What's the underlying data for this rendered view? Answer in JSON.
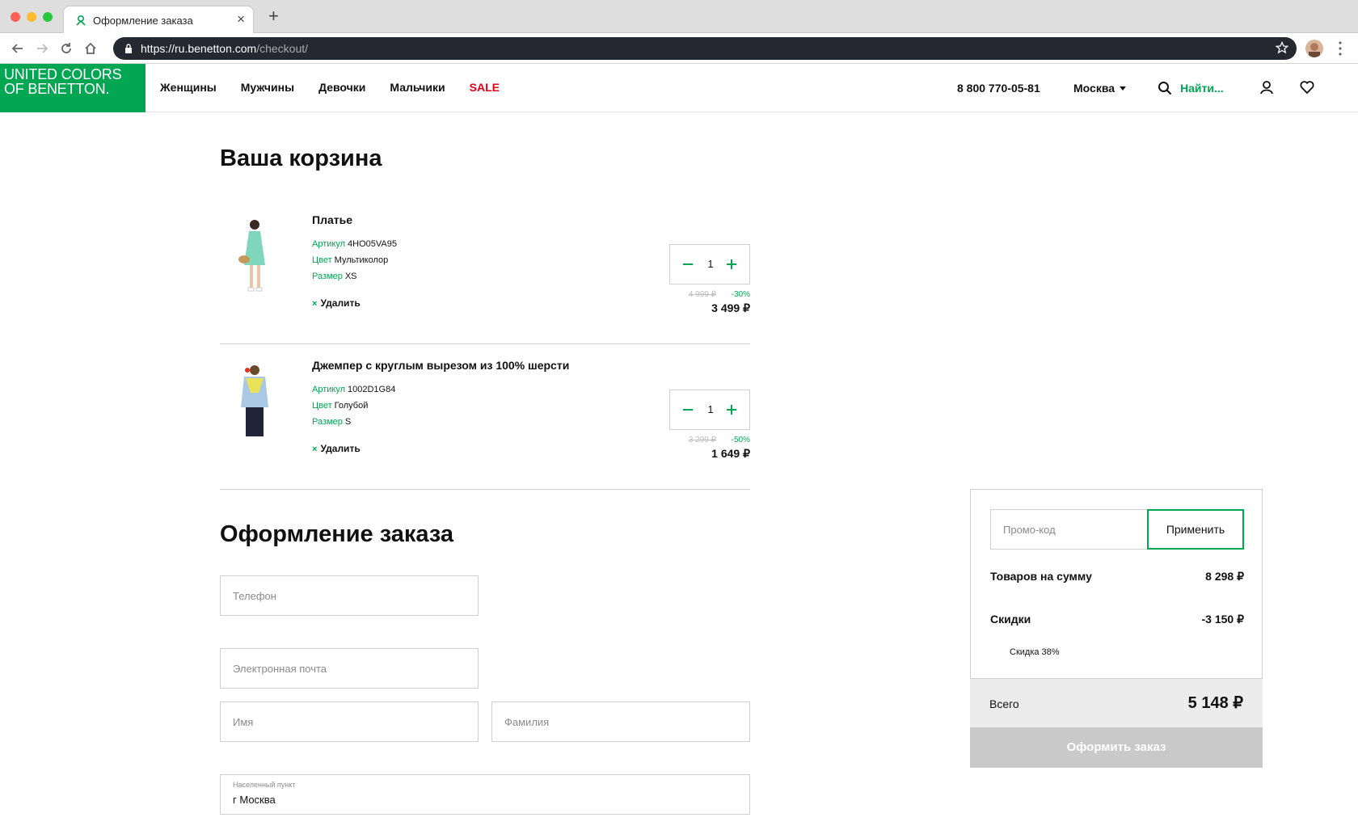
{
  "browser": {
    "tab_title": "Оформление заказа",
    "new_tab_label": "+",
    "url_host": "https://ru.benetton.com",
    "url_path": "/checkout/"
  },
  "header": {
    "logo_line1": "UNITED COLORS",
    "logo_line2": "OF BENETTON.",
    "nav": [
      "Женщины",
      "Мужчины",
      "Девочки",
      "Мальчики",
      "SALE"
    ],
    "phone": "8 800 770-05-81",
    "city": "Москва",
    "search_label": "Найти..."
  },
  "cart": {
    "title": "Ваша корзина",
    "items": [
      {
        "name": "Платье",
        "sku_label": "Артикул",
        "sku": "4HO05VA95",
        "color_label": "Цвет",
        "color": "Мультиколор",
        "size_label": "Размер",
        "size": "XS",
        "remove": "Удалить",
        "qty": "1",
        "old_price": "4 999 ₽",
        "discount": "-30%",
        "price": "3 499 ₽"
      },
      {
        "name": "Джемпер с круглым вырезом из 100% шерсти",
        "sku_label": "Артикул",
        "sku": "1002D1G84",
        "color_label": "Цвет",
        "color": "Голубой",
        "size_label": "Размер",
        "size": "S",
        "remove": "Удалить",
        "qty": "1",
        "old_price": "3 299 ₽",
        "discount": "-50%",
        "price": "1 649 ₽"
      }
    ]
  },
  "checkout": {
    "title": "Оформление заказа",
    "phone_placeholder": "Телефон",
    "email_placeholder": "Электронная почта",
    "first_name_placeholder": "Имя",
    "last_name_placeholder": "Фамилия",
    "city_label": "Населенный пункт",
    "city_value": "г Москва"
  },
  "summary": {
    "promo_placeholder": "Промо-код",
    "apply_label": "Применить",
    "goods_label": "Товаров на сумму",
    "goods_value": "8 298 ₽",
    "discounts_label": "Скидки",
    "discounts_value": "-3 150 ₽",
    "discount_note": "Скидка 38%",
    "total_label": "Всего",
    "total_value": "5 148 ₽",
    "checkout_label": "Оформить заказ"
  },
  "colors": {
    "brand_green": "#00a651",
    "sale_red": "#e3001b"
  },
  "icons": [
    "benetton-favicon-icon",
    "back-icon",
    "forward-icon",
    "reload-icon",
    "home-icon",
    "lock-icon",
    "star-icon",
    "menu-dots-icon",
    "search-icon",
    "user-icon",
    "heart-icon",
    "minus-icon",
    "plus-icon",
    "close-x-icon"
  ]
}
